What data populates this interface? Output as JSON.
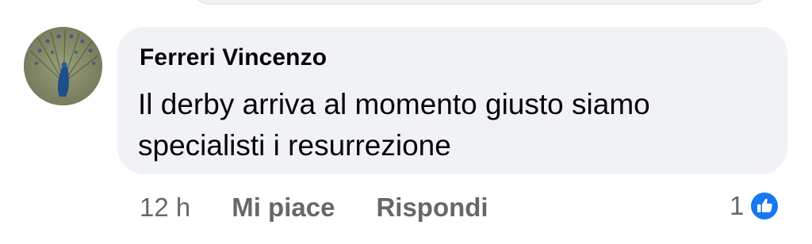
{
  "comment": {
    "author": "Ferreri Vincenzo",
    "text": "Il derby arriva al momento giusto siamo specialisti i resurrezione",
    "avatar_icon": "peacock-avatar"
  },
  "actions": {
    "time": "12 h",
    "like_label": "Mi piace",
    "reply_label": "Rispondi"
  },
  "reactions": {
    "count": "1",
    "icon": "like-thumbs-up-icon",
    "color": "#1877f2"
  },
  "colors": {
    "bubble": "#f0f2f5",
    "secondary_text": "#65676b",
    "primary_text": "#050505"
  }
}
